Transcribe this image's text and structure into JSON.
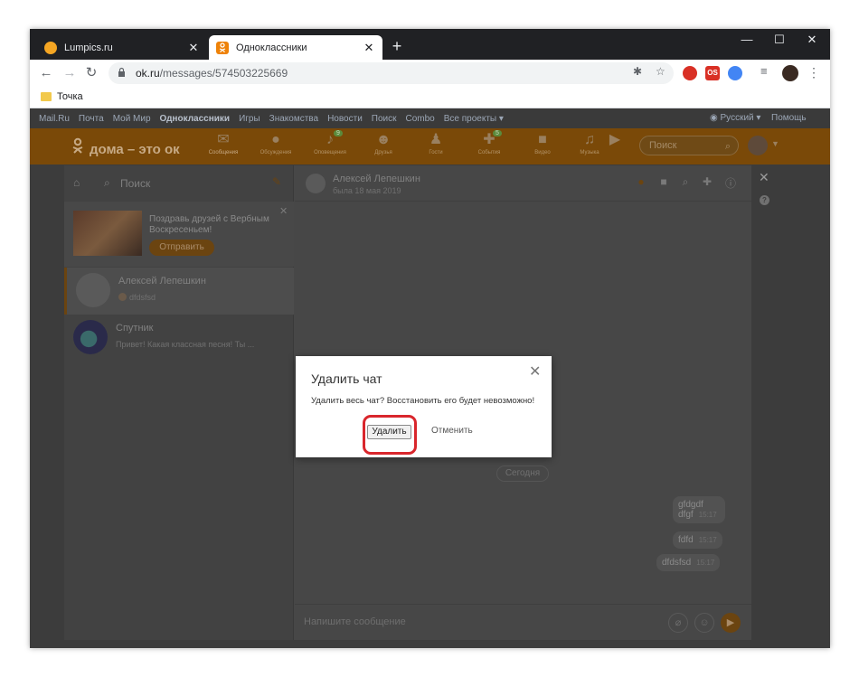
{
  "browser": {
    "tabs": [
      {
        "label": "Lumpics.ru",
        "close": "✕"
      },
      {
        "label": "Одноклассники",
        "close": "✕"
      }
    ],
    "new_tab": "+",
    "window": {
      "minimize": "—",
      "maximize": "☐",
      "close": "✕"
    },
    "url_host": "ok.ru",
    "url_path": "/messages/574503225669",
    "bookmark": "Точка",
    "extensions": {
      "ext1": "",
      "ext2": "OS"
    }
  },
  "portal": {
    "links": [
      "Mail.Ru",
      "Почта",
      "Мой Мир",
      "Одноклассники",
      "Игры",
      "Знакомства",
      "Новости",
      "Поиск",
      "Combo",
      "Все проекты ▾"
    ],
    "language": "Русский ▾",
    "help": "Помощь"
  },
  "ok_nav": {
    "logo": "дома – это ок",
    "items": [
      {
        "label": "Сообщения"
      },
      {
        "label": "Обсуждения"
      },
      {
        "label": "Оповещения",
        "badge": "9"
      },
      {
        "label": "Друзья"
      },
      {
        "label": "Гости"
      },
      {
        "label": "События",
        "badge": "5"
      },
      {
        "label": "Видео"
      },
      {
        "label": "Музыка"
      }
    ],
    "search_placeholder": "Поиск"
  },
  "sidebar": {
    "search_placeholder": "Поиск",
    "promo": {
      "text": "Поздравь друзей с Вербным Воскресеньем!",
      "button": "Отправить"
    },
    "chats": [
      {
        "name": "Алексей Лепешкин",
        "preview": "dfdsfsd"
      },
      {
        "name": "Спутник",
        "preview": "Привет! Какая классная песня! Ты ..."
      }
    ]
  },
  "conversation": {
    "name": "Алексей Лепешкин",
    "last_seen": "была 18 мая 2019",
    "date_chip": "Сегодня",
    "messages": [
      {
        "lines": [
          "gfdgdf",
          "dfgf"
        ],
        "time": "15:17"
      },
      {
        "lines": [
          "fdfd"
        ],
        "time": "15:17"
      },
      {
        "lines": [
          "dfdsfsd"
        ],
        "time": "15:17"
      }
    ],
    "composer_placeholder": "Напишите сообщение"
  },
  "dialog": {
    "title": "Удалить чат",
    "text": "Удалить весь чат? Восстановить его будет невозможно!",
    "confirm": "Удалить",
    "cancel": "Отменить",
    "close": "✕"
  },
  "colors": {
    "ok_orange": "#ee8208",
    "highlight_red": "#d9262c"
  }
}
